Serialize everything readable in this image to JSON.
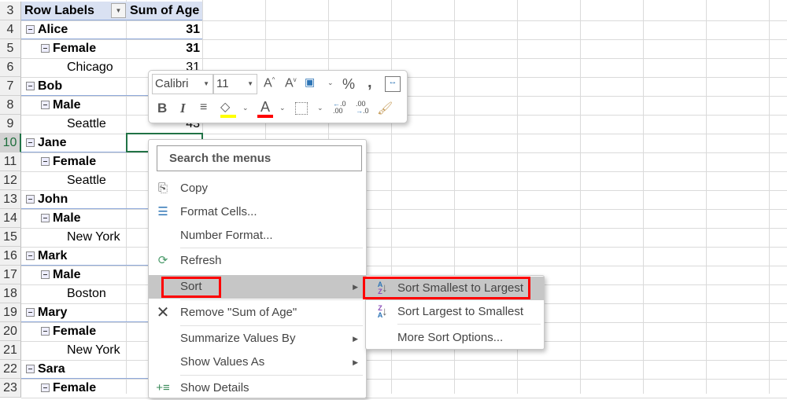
{
  "pivot": {
    "header_row": "3",
    "row_labels": "Row Labels",
    "sum_header": "Sum of Age",
    "rows": [
      {
        "row": "4",
        "label": "Alice",
        "level": 0,
        "value": "31"
      },
      {
        "row": "5",
        "label": "Female",
        "level": 1,
        "value": "31"
      },
      {
        "row": "6",
        "label": "Chicago",
        "level": 2,
        "value": "31"
      },
      {
        "row": "7",
        "label": "Bob",
        "level": 0,
        "value": ""
      },
      {
        "row": "8",
        "label": "Male",
        "level": 1,
        "value": ""
      },
      {
        "row": "9",
        "label": "Seattle",
        "level": 2,
        "value": "43"
      },
      {
        "row": "10",
        "label": "Jane",
        "level": 0,
        "value": ""
      },
      {
        "row": "11",
        "label": "Female",
        "level": 1,
        "value": ""
      },
      {
        "row": "12",
        "label": "Seattle",
        "level": 2,
        "value": ""
      },
      {
        "row": "13",
        "label": "John",
        "level": 0,
        "value": ""
      },
      {
        "row": "14",
        "label": "Male",
        "level": 1,
        "value": ""
      },
      {
        "row": "15",
        "label": "New York",
        "level": 2,
        "value": ""
      },
      {
        "row": "16",
        "label": "Mark",
        "level": 0,
        "value": ""
      },
      {
        "row": "17",
        "label": "Male",
        "level": 1,
        "value": ""
      },
      {
        "row": "18",
        "label": "Boston",
        "level": 2,
        "value": ""
      },
      {
        "row": "19",
        "label": "Mary",
        "level": 0,
        "value": ""
      },
      {
        "row": "20",
        "label": "Female",
        "level": 1,
        "value": ""
      },
      {
        "row": "21",
        "label": "New York",
        "level": 2,
        "value": ""
      },
      {
        "row": "22",
        "label": "Sara",
        "level": 0,
        "value": ""
      },
      {
        "row": "23",
        "label": "Female",
        "level": 1,
        "value": ""
      }
    ]
  },
  "mini_toolbar": {
    "font": "Calibri",
    "size": "11",
    "bold": "B",
    "italic": "I",
    "percent": "%",
    "comma": ",",
    "font_color": "#ff0000",
    "highlight_color": "#ffff00",
    "inc_decimal": ".00",
    "dec_decimal": ".0"
  },
  "context_menu": {
    "search_placeholder": "Search the menus",
    "items": [
      {
        "label": "Copy",
        "icon": "copy-icon"
      },
      {
        "label": "Format Cells...",
        "icon": "format-cells-icon"
      },
      {
        "label": "Number Format...",
        "icon": ""
      },
      {
        "label": "Refresh",
        "icon": "refresh-icon"
      },
      {
        "label": "Sort",
        "icon": "",
        "submenu": true,
        "highlighted": true
      },
      {
        "label": "Remove \"Sum of Age\"",
        "icon": "remove-icon"
      },
      {
        "label": "Summarize Values By",
        "icon": "",
        "submenu": true
      },
      {
        "label": "Show Values As",
        "icon": "",
        "submenu": true
      },
      {
        "label": "Show Details",
        "icon": "show-details-icon"
      }
    ]
  },
  "sort_submenu": {
    "items": [
      {
        "label": "Sort Smallest to Largest",
        "icon": "sort-ascending-icon",
        "highlighted": true
      },
      {
        "label": "Sort Largest to Smallest",
        "icon": "sort-descending-icon"
      },
      {
        "label": "More Sort Options...",
        "icon": ""
      }
    ]
  },
  "colors": {
    "highlight_box": "#ff0000",
    "selection": "#217346",
    "pivot_header": "#d9e1f2",
    "menu_hover": "#c6c6c6"
  }
}
